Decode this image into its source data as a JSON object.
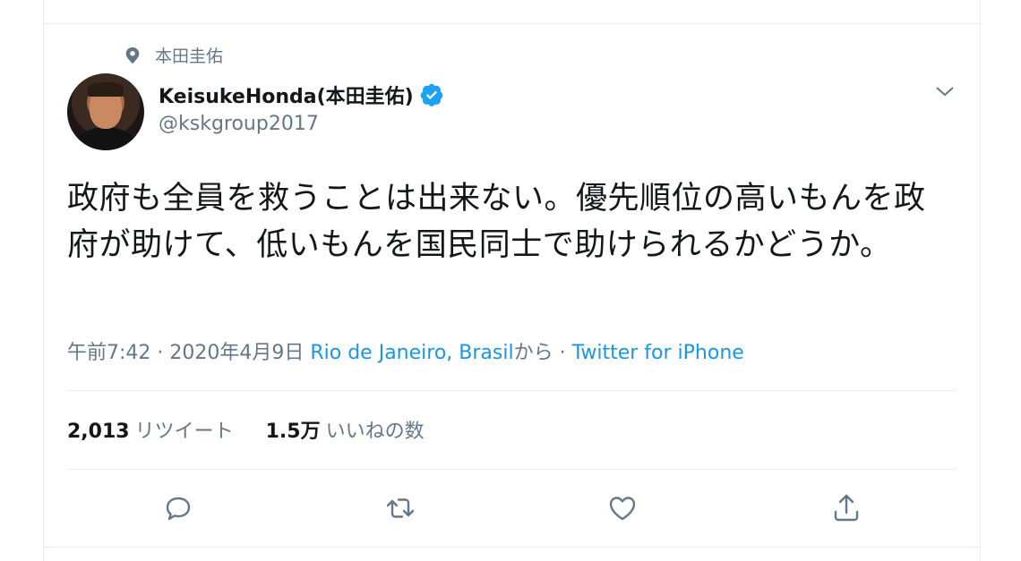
{
  "pinned": {
    "icon": "location-pin-icon",
    "label": "本田圭佑"
  },
  "author": {
    "display_name": "KeisukeHonda(本田圭佑)",
    "handle": "@kskgroup2017",
    "verified_icon": "verified-badge-icon"
  },
  "tweet": {
    "text": "政府も全員を救うことは出来ない。優先順位の高いもんを政府が助けて、低いもんを国民同士で助けられるかどうか。",
    "time": "午前7:42 · 2020年4月9日 ",
    "location": "Rio de Janeiro, Brasil",
    "from_suffix": "から",
    "sep": " · ",
    "client": "Twitter for iPhone"
  },
  "stats": {
    "retweets_count": "2,013",
    "retweets_label": "リツイート",
    "likes_count": "1.5万",
    "likes_label": "いいねの数"
  },
  "actions": [
    {
      "name": "reply-icon"
    },
    {
      "name": "retweet-icon"
    },
    {
      "name": "like-icon"
    },
    {
      "name": "share-icon"
    }
  ],
  "colors": {
    "link": "#1b95e0",
    "muted": "#657786",
    "text": "#14171a",
    "verified": "#1da1f2"
  }
}
